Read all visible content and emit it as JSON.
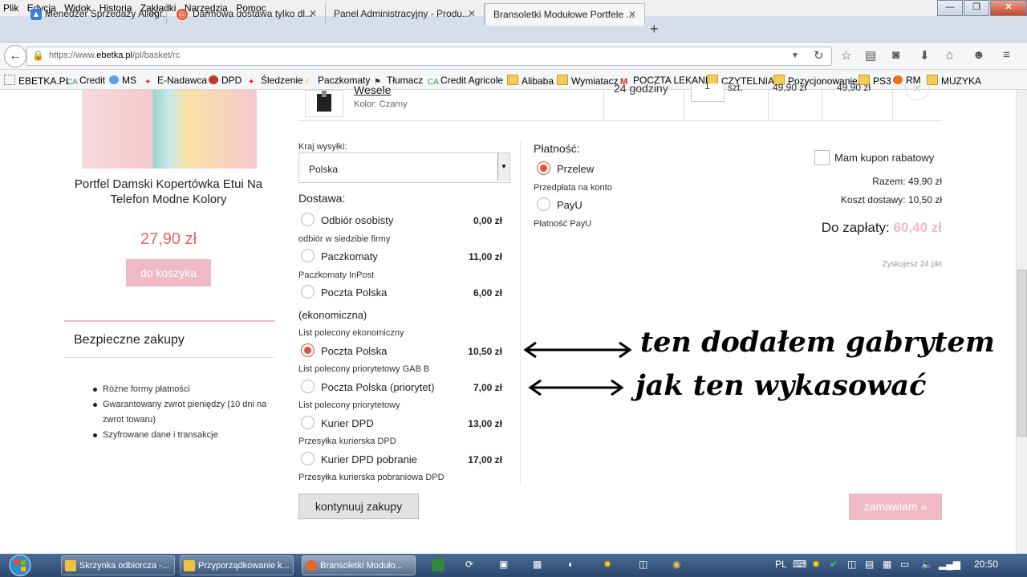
{
  "menu": [
    "Plik",
    "Edycja",
    "Widok",
    "Historia",
    "Zakładki",
    "Narzędzia",
    "Pomoc"
  ],
  "window_buttons": {
    "minimize": "—",
    "maximize": "❐",
    "close": "✕"
  },
  "tabs": [
    {
      "label": "Menedżer Sprzedaży Allegr...",
      "icon_color": "#3b7dd8"
    },
    {
      "label": "Darmowa dostawa tylko dl...",
      "icon_color": "#e05a2a"
    },
    {
      "label": "Panel Administracyjny - Produ...",
      "icon_color": "#999999"
    },
    {
      "label": "Bransoletki Modułowe Portfele ...",
      "icon_color": "#999999"
    }
  ],
  "url": {
    "protocol": "https://www.",
    "domain": "ebetka.pl",
    "path": "/pl/basket/rc"
  },
  "bookmarks": [
    "EBETKA.PL",
    "Credit",
    "MS",
    "E-Nadawca",
    "DPD",
    "Śledzenie",
    "Paczkomaty",
    "Tłumacz",
    "Credit Agricole",
    "Alibaba",
    "Wymiatacz",
    "POCZTA LEKANI",
    "CZYTELNIA",
    "Pozycjonowanie",
    "PS3",
    "RM",
    "MUZYKA"
  ],
  "product_sidebar": {
    "title": "Portfel Damski Kopertówka Etui Na Telefon Modne Kolory",
    "price": "27,90 zł",
    "add_button": "do koszyka"
  },
  "secure": {
    "heading": "Bezpieczne zakupy",
    "items": [
      "Różne formy płatności",
      "Gwarantowany zwrot pieniędzy (10 dni na zwrot towaru)",
      "Szyfrowane dane i transakcje"
    ]
  },
  "cart_row": {
    "name": "Wesele",
    "color": "Kolor: Czarny",
    "delivery": "24 godziny",
    "qty": "1",
    "unit": "szt.",
    "price": "49,90 zł",
    "total": "49,90 zł"
  },
  "shipping": {
    "country_label": "Kraj wysyłki:",
    "country": "Polska",
    "select_arrow": "▼",
    "heading": "Dostawa:",
    "options": [
      {
        "name": "Odbiór osobisty",
        "price": "0,00 zł",
        "desc": "odbiór w siedzibie firmy",
        "selected": false
      },
      {
        "name": "Paczkomaty",
        "price": "11,00 zł",
        "desc": "Paczkomaty InPost",
        "selected": false
      },
      {
        "name": "Poczta Polska",
        "price": "6,00 zł",
        "desc": "(ekonomiczna)",
        "selected": false
      },
      {
        "name": "Poczta Polska",
        "price": "10,50 zł",
        "desc": "List polecony ekonomiczny",
        "pre": true,
        "selected": true
      },
      {
        "name": "Poczta Polska (priorytet)",
        "price": "7,00 zł",
        "desc": "List polecony priorytetowy GAB B",
        "pre": true,
        "selected": false
      },
      {
        "name": "Kurier DPD",
        "price": "13,00 zł",
        "desc": "List polecony priorytetowy",
        "pre": true,
        "selected": false
      },
      {
        "name": "Kurier DPD pobranie",
        "price": "17,00 zł",
        "desc": "Przesyłka kurierska DPD",
        "pre": true,
        "selected": false
      }
    ],
    "last_desc": "Przesyłka kurierska pobraniowa DPD"
  },
  "payment": {
    "heading": "Płatność:",
    "options": [
      {
        "name": "Przelew",
        "desc": "Przedpłata na konto",
        "selected": true
      },
      {
        "name": "PayU",
        "desc": "Płatność PayU",
        "selected": false
      }
    ]
  },
  "summary": {
    "coupon": "Mam kupon rabatowy",
    "subtotal": "Razem: 49,90 zł",
    "shipping_cost": "Koszt dostawy: 10,50 zł",
    "to_pay_label": "Do zapłaty:",
    "to_pay_value": "60,40 zł",
    "points": "Zyskujesz 24 pkt"
  },
  "buttons": {
    "continue": "kontynuuj zakupy",
    "order": "zamawiam »"
  },
  "annotations": [
    "ten dodałem gabrytem",
    "jak ten wykasować"
  ],
  "taskbar": {
    "items": [
      {
        "label": "Skrzynka odbiorcza -...",
        "icon_color": "#f0c040"
      },
      {
        "label": "Przyporządkowanie k...",
        "icon_color": "#f0c040"
      },
      {
        "label": "Bransoletki Moduło...",
        "icon_color": "#e0692a"
      }
    ],
    "lang": "PL",
    "time": "20:50"
  },
  "colors": {
    "accent_pink": "#efbac4",
    "price_red": "#e06666",
    "radio_red": "#e74c3c"
  }
}
